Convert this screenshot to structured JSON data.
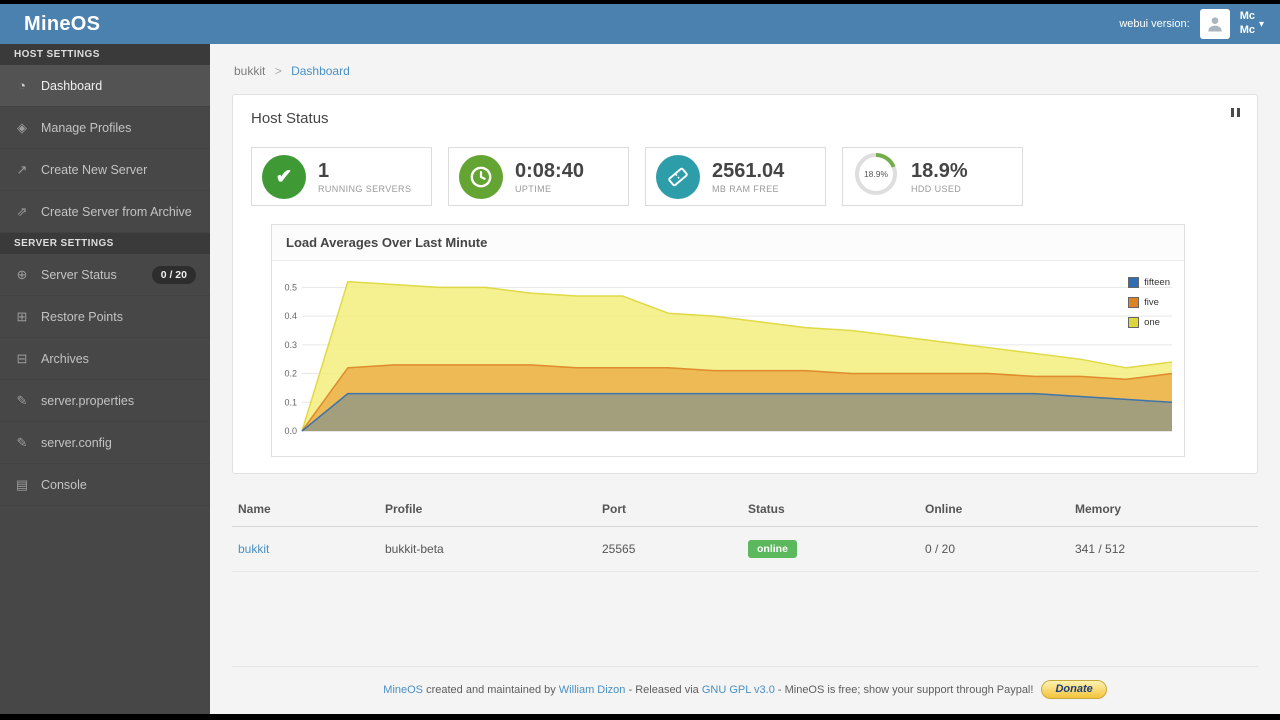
{
  "header": {
    "brand": "MineOS",
    "version_label": "webui version:",
    "user": {
      "line1": "Mc",
      "line2": "Mc"
    }
  },
  "sidebar": {
    "sections": [
      {
        "title": "HOST SETTINGS",
        "items": [
          {
            "label": "Dashboard"
          },
          {
            "label": "Manage Profiles"
          },
          {
            "label": "Create New Server"
          },
          {
            "label": "Create Server from Archive"
          }
        ]
      },
      {
        "title": "SERVER SETTINGS",
        "items": [
          {
            "label": "Server Status",
            "badge": "0 / 20"
          },
          {
            "label": "Restore Points"
          },
          {
            "label": "Archives"
          },
          {
            "label": "server.properties"
          },
          {
            "label": "server.config"
          },
          {
            "label": "Console"
          }
        ]
      }
    ]
  },
  "breadcrumb": {
    "parent": "bukkit",
    "separator": ">",
    "current": "Dashboard"
  },
  "host_status": {
    "title": "Host Status",
    "tiles": [
      {
        "value": "1",
        "label": "RUNNING SERVERS",
        "icon": "check-icon",
        "color": "#3f9a36"
      },
      {
        "value": "0:08:40",
        "label": "UPTIME",
        "icon": "clock-icon",
        "color": "#64a433"
      },
      {
        "value": "2561.04",
        "label": "MB RAM FREE",
        "icon": "ticket-icon",
        "color": "#2e9daa"
      },
      {
        "value": "18.9%",
        "label": "HDD USED",
        "icon": "donut-gauge",
        "percent": 18.9,
        "donut_text": "18.9%"
      }
    ]
  },
  "chart_data": {
    "type": "area",
    "title": "Load Averages Over Last Minute",
    "x": [
      0,
      1,
      2,
      3,
      4,
      5,
      6,
      7,
      8,
      9,
      10,
      11,
      12,
      13,
      14,
      15,
      16,
      17,
      18,
      19
    ],
    "ylim": [
      0,
      0.55
    ],
    "yticks": [
      0,
      0.1,
      0.2,
      0.3,
      0.4,
      0.5
    ],
    "grid": true,
    "legend_position": "top-right",
    "series": [
      {
        "name": "fifteen",
        "color": "#2f6eb4",
        "fill": "#4a7fae",
        "opacity": 0.45,
        "values": [
          0,
          0.13,
          0.13,
          0.13,
          0.13,
          0.13,
          0.13,
          0.13,
          0.13,
          0.13,
          0.13,
          0.13,
          0.13,
          0.13,
          0.13,
          0.13,
          0.13,
          0.12,
          0.11,
          0.1
        ]
      },
      {
        "name": "five",
        "color": "#dd8327",
        "fill": "#e8962f",
        "opacity": 0.6,
        "values": [
          0,
          0.22,
          0.23,
          0.23,
          0.23,
          0.23,
          0.22,
          0.22,
          0.22,
          0.21,
          0.21,
          0.21,
          0.2,
          0.2,
          0.2,
          0.2,
          0.19,
          0.19,
          0.18,
          0.2
        ]
      },
      {
        "name": "one",
        "color": "#ddd63a",
        "fill": "#f3ef7d",
        "opacity": 0.85,
        "values": [
          0,
          0.52,
          0.51,
          0.5,
          0.5,
          0.48,
          0.47,
          0.47,
          0.41,
          0.4,
          0.38,
          0.36,
          0.35,
          0.33,
          0.31,
          0.29,
          0.27,
          0.25,
          0.22,
          0.24
        ]
      }
    ]
  },
  "servers_table": {
    "headers": [
      "Name",
      "Profile",
      "Port",
      "Status",
      "Online",
      "Memory"
    ],
    "rows": [
      {
        "name": "bukkit",
        "profile": "bukkit-beta",
        "port": "25565",
        "status": "online",
        "online": "0 / 20",
        "memory": "341 / 512"
      }
    ],
    "status_color": "#5cb85c"
  },
  "footer": {
    "link1": "MineOS",
    "text1": " created and maintained by ",
    "link2": "William Dizon",
    "text2": " - Released via ",
    "link3": "GNU GPL v3.0",
    "text3": " - MineOS is free; show your support through Paypal!",
    "donate_label": "Donate"
  }
}
